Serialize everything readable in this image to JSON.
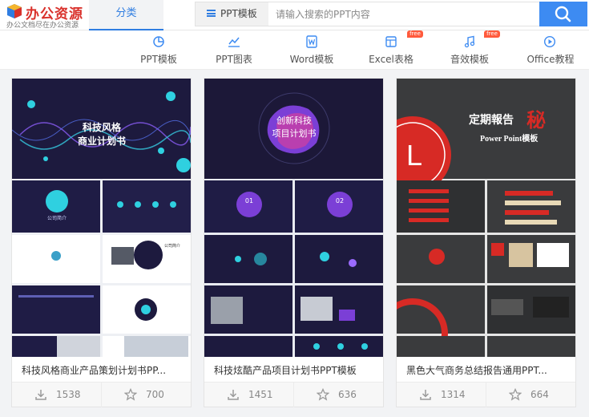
{
  "logo": {
    "title": "办公资源",
    "subtitle": "办公文档尽在办公资源"
  },
  "nav": {
    "active_tab": "分类"
  },
  "search": {
    "type_label": "PPT模板",
    "placeholder": "请输入搜索的PPT内容",
    "value": ""
  },
  "categories": [
    {
      "label": "PPT模板",
      "icon": "pie-chart-icon"
    },
    {
      "label": "PPT图表",
      "icon": "line-chart-icon"
    },
    {
      "label": "Word模板",
      "icon": "word-doc-icon",
      "badge": ""
    },
    {
      "label": "Excel表格",
      "icon": "excel-table-icon",
      "badge": "free"
    },
    {
      "label": "音效模板",
      "icon": "music-note-icon",
      "badge": "free"
    },
    {
      "label": "Office教程",
      "icon": "play-circle-icon"
    }
  ],
  "cards": [
    {
      "title": "科技风格商业产品策划计划书PP...",
      "downloads": "1538",
      "favorites": "700",
      "cover": {
        "line1": "科技风格",
        "line2": "商业计划书",
        "sub1": "公司简介",
        "sub2": "公司简介"
      }
    },
    {
      "title": "科技炫酷产品项目计划书PPT模板",
      "downloads": "1451",
      "favorites": "636",
      "cover": {
        "line1": "创新科技",
        "line2": "项目计划书",
        "sub1": "01",
        "sub2": "02"
      }
    },
    {
      "title": "黑色大气商务总结报告通用PPT...",
      "downloads": "1314",
      "favorites": "664",
      "cover": {
        "line1": "定期報告",
        "accent": "秘",
        "line2": "Power Point模板",
        "letter": "L"
      }
    }
  ],
  "colors": {
    "accent": "#3d8bf2",
    "brand": "#d9312b",
    "badge": "#ff5a3c"
  }
}
